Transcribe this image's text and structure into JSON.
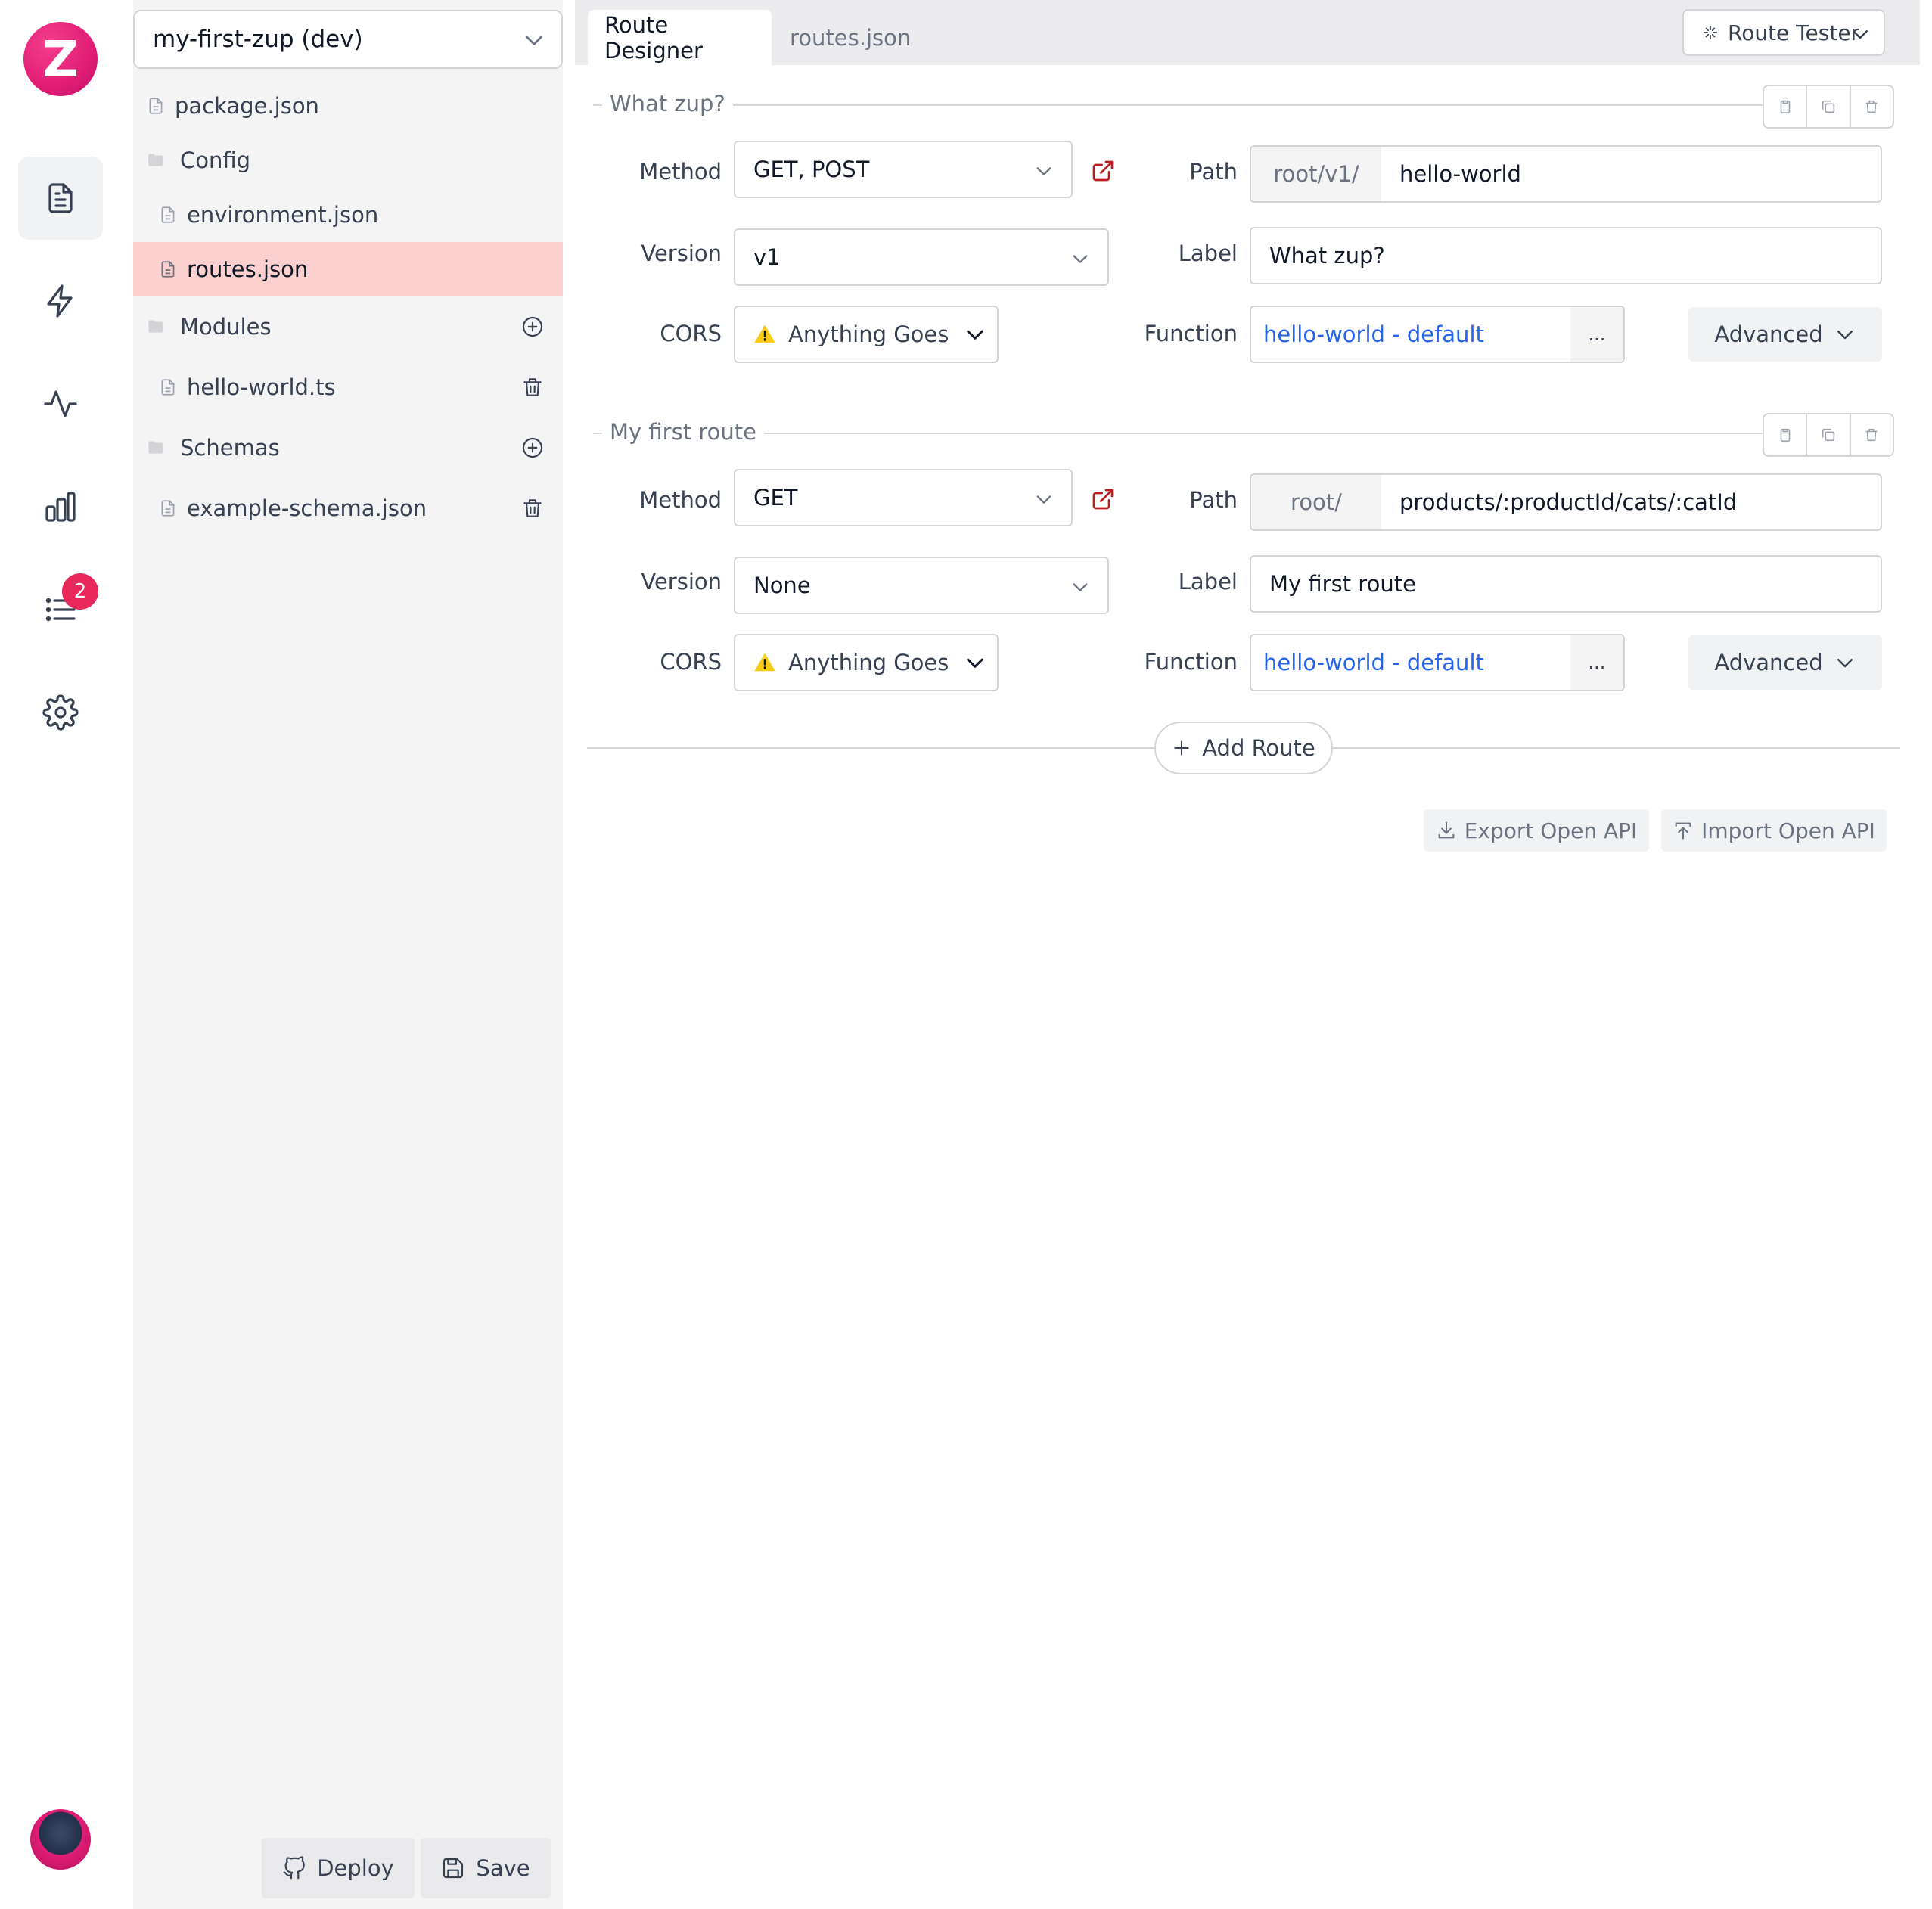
{
  "rail": {
    "logo_letter": "Z",
    "items": [
      "files-icon",
      "bolt-icon",
      "activity-icon",
      "analytics-icon",
      "logs-icon",
      "settings-icon"
    ],
    "logs_badge": "2"
  },
  "project": {
    "selected": "my-first-zup (dev)"
  },
  "files": [
    {
      "name": "package.json",
      "type": "file"
    },
    {
      "name": "Config",
      "type": "folder"
    },
    {
      "name": "environment.json",
      "type": "file"
    },
    {
      "name": "routes.json",
      "type": "file",
      "active": true
    },
    {
      "name": "Modules",
      "type": "folder",
      "action": "add"
    },
    {
      "name": "hello-world.ts",
      "type": "file",
      "action": "delete"
    },
    {
      "name": "Schemas",
      "type": "folder",
      "action": "add"
    },
    {
      "name": "example-schema.json",
      "type": "file",
      "action": "delete"
    }
  ],
  "footer": {
    "deploy": "Deploy",
    "save": "Save"
  },
  "tabs": {
    "designer": "Route Designer",
    "raw": "routes.json",
    "tester": "Route Tester"
  },
  "labels": {
    "method": "Method",
    "path": "Path",
    "version": "Version",
    "label": "Label",
    "cors": "CORS",
    "function": "Function",
    "advanced": "Advanced"
  },
  "routes": [
    {
      "title": "What zup?",
      "method": "GET, POST",
      "path_prefix": "root/v1/",
      "path": "hello-world",
      "version": "v1",
      "label": "What zup?",
      "cors": "Anything Goes",
      "function": "hello-world - default",
      "function_more": "..."
    },
    {
      "title": "My first route",
      "method": "GET",
      "path_prefix": "root/",
      "path": "products/:productId/cats/:catId",
      "version": "None",
      "label": "My first route",
      "cors": "Anything Goes",
      "function": "hello-world - default",
      "function_more": "..."
    }
  ],
  "actions": {
    "add_route": "Add Route",
    "export": "Export Open API",
    "import": "Import Open API"
  },
  "colors": {
    "brand": "#e11d74",
    "active_file": "#fdd0d0",
    "link": "#2563eb",
    "warning": "#facc15"
  }
}
